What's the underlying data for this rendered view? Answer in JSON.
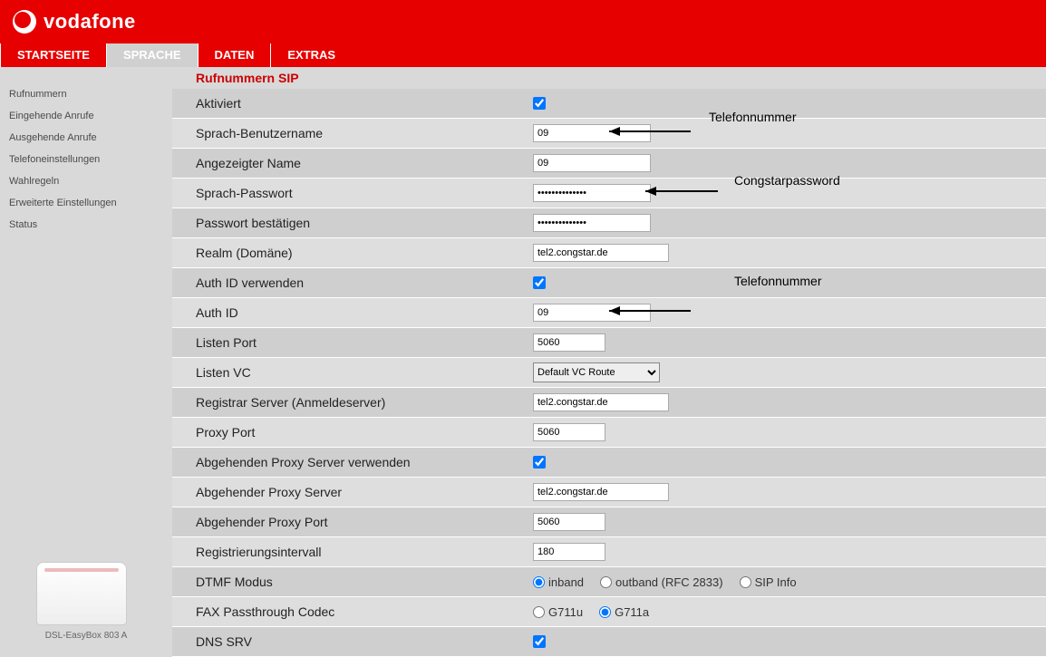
{
  "brand": "vodafone",
  "nav": {
    "items": [
      "STARTSEITE",
      "SPRACHE",
      "DATEN",
      "EXTRAS"
    ],
    "active_index": 1
  },
  "sidebar": {
    "items": [
      "Rufnummern",
      "Eingehende Anrufe",
      "Ausgehende Anrufe",
      "Telefoneinstellungen",
      "Wahlregeln",
      "Erweiterte Einstellungen",
      "Status"
    ],
    "device_label": "DSL-EasyBox 803 A"
  },
  "page_title": "Rufnummern SIP",
  "annotations": {
    "tel1": "Telefonnummer",
    "congstar": "Congstarpassword",
    "tel2": "Telefonnummer"
  },
  "form": {
    "aktiviert": {
      "label": "Aktiviert",
      "checked": true
    },
    "sprach_user": {
      "label": "Sprach-Benutzername",
      "value": "09"
    },
    "angezeigter_name": {
      "label": "Angezeigter Name",
      "value": "09"
    },
    "sprach_passwort": {
      "label": "Sprach-Passwort",
      "value": "••••••••••••••"
    },
    "passwort_best": {
      "label": "Passwort bestätigen",
      "value": "••••••••••••••"
    },
    "realm": {
      "label": "Realm (Domäne)",
      "value": "tel2.congstar.de"
    },
    "auth_id_use": {
      "label": "Auth ID verwenden",
      "checked": true
    },
    "auth_id": {
      "label": "Auth ID",
      "value": "09"
    },
    "listen_port": {
      "label": "Listen Port",
      "value": "5060"
    },
    "listen_vc": {
      "label": "Listen VC",
      "value": "Default VC Route"
    },
    "registrar": {
      "label": "Registrar Server (Anmeldeserver)",
      "value": "tel2.congstar.de"
    },
    "proxy_port": {
      "label": "Proxy Port",
      "value": "5060"
    },
    "out_proxy_use": {
      "label": "Abgehenden Proxy Server verwenden",
      "checked": true
    },
    "out_proxy": {
      "label": "Abgehender Proxy Server",
      "value": "tel2.congstar.de"
    },
    "out_proxy_port": {
      "label": "Abgehender Proxy Port",
      "value": "5060"
    },
    "reg_interval": {
      "label": "Registrierungsintervall",
      "value": "180"
    },
    "dtmf": {
      "label": "DTMF Modus",
      "options": [
        "inband",
        "outband (RFC 2833)",
        "SIP Info"
      ],
      "selected": "inband"
    },
    "fax": {
      "label": "FAX Passthrough Codec",
      "options": [
        "G711u",
        "G711a"
      ],
      "selected": "G711a"
    },
    "dns_srv": {
      "label": "DNS SRV",
      "checked": true
    }
  }
}
